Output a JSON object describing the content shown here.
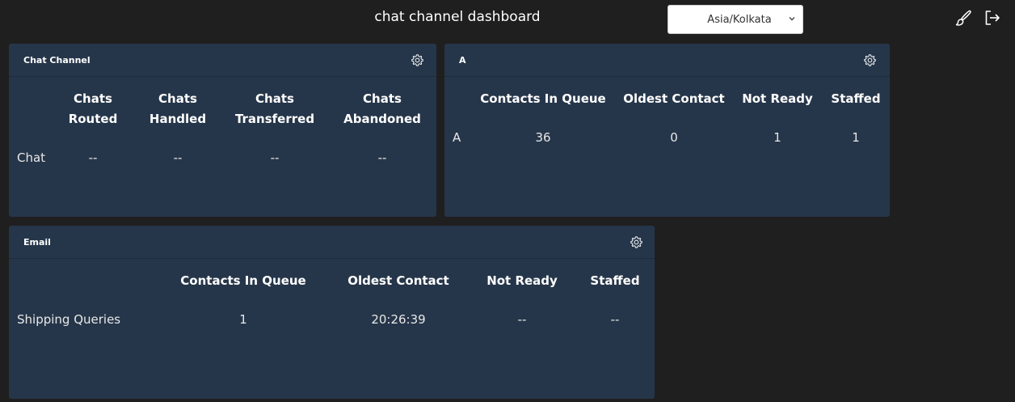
{
  "header": {
    "title": "chat channel dashboard",
    "timezone": "Asia/Kolkata"
  },
  "icons": {
    "brush": "paintbrush-icon",
    "logout": "logout-icon",
    "gear": "gear-icon",
    "chevron": "chevron-down-icon"
  },
  "panels": {
    "chat_channel": {
      "title": "Chat Channel",
      "columns": [
        [
          "Chats",
          "Routed"
        ],
        [
          "Chats",
          "Handled"
        ],
        [
          "Chats",
          "Transferred"
        ],
        [
          "Chats",
          "Abandoned"
        ]
      ],
      "row_label": "Chat",
      "values": [
        "--",
        "--",
        "--",
        "--"
      ]
    },
    "queue_a": {
      "title": "A",
      "columns": [
        "Contacts In Queue",
        "Oldest Contact",
        "Not Ready",
        "Staffed"
      ],
      "row_label": "A",
      "values": [
        "36",
        "0",
        "1",
        "1"
      ]
    },
    "email": {
      "title": "Email",
      "columns": [
        "Contacts In Queue",
        "Oldest Contact",
        "Not Ready",
        "Staffed"
      ],
      "row_label": "Shipping Queries",
      "values": [
        "1",
        "20:26:39",
        "--",
        "--"
      ]
    }
  },
  "colors": {
    "background": "#1f1f1f",
    "panel": "#26364a",
    "text": "#ffffff"
  }
}
